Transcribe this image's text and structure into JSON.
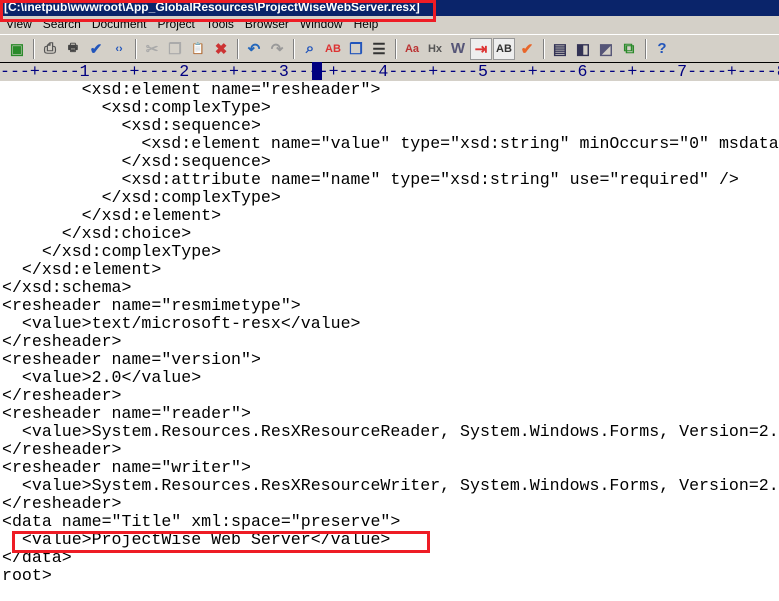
{
  "window": {
    "title": "[C:\\inetpub\\wwwroot\\App_GlobalResources\\ProjectWiseWebServer.resx]"
  },
  "menu": [
    "View",
    "Search",
    "Document",
    "Project",
    "Tools",
    "Browser",
    "Window",
    "Help"
  ],
  "toolbar": [
    {
      "icon": "save-all-icon",
      "glyph": "▣",
      "color": "#2a8a2a"
    },
    {
      "sep": true
    },
    {
      "icon": "print-preview-icon",
      "glyph": "⎙",
      "color": "#555"
    },
    {
      "icon": "print-icon",
      "glyph": "🖶",
      "color": "#444"
    },
    {
      "icon": "spellcheck-icon",
      "glyph": "✔",
      "color": "#2255bb"
    },
    {
      "icon": "html-tag-icon",
      "glyph": "‹›",
      "color": "#2255bb"
    },
    {
      "sep": true
    },
    {
      "icon": "cut-icon",
      "glyph": "✂",
      "color": "#aaa"
    },
    {
      "icon": "copy-icon",
      "glyph": "❐",
      "color": "#aaa"
    },
    {
      "icon": "paste-icon",
      "glyph": "📋",
      "color": "#8a6a2a"
    },
    {
      "icon": "delete-icon",
      "glyph": "✖",
      "color": "#c33"
    },
    {
      "sep": true
    },
    {
      "icon": "undo-icon",
      "glyph": "↶",
      "color": "#2266bb"
    },
    {
      "icon": "redo-icon",
      "glyph": "↷",
      "color": "#999"
    },
    {
      "sep": true
    },
    {
      "icon": "find-icon",
      "glyph": "⌕",
      "color": "#2255bb"
    },
    {
      "icon": "replace-icon",
      "glyph": "AB",
      "color": "#d33"
    },
    {
      "icon": "find-in-files-icon",
      "glyph": "❒",
      "color": "#2255bb"
    },
    {
      "icon": "line-numbers-icon",
      "glyph": "☰",
      "color": "#333"
    },
    {
      "sep": true
    },
    {
      "icon": "font-icon",
      "glyph": "Aa",
      "color": "#b33"
    },
    {
      "icon": "hex-icon",
      "glyph": "Hx",
      "color": "#555"
    },
    {
      "icon": "word-wrap-icon",
      "glyph": "W",
      "color": "#557"
    },
    {
      "icon": "indent-icon",
      "glyph": "⇥",
      "color": "#d33",
      "on": true
    },
    {
      "icon": "sort-icon",
      "glyph": "AB",
      "color": "#333",
      "on": true
    },
    {
      "icon": "check-icon",
      "glyph": "✔",
      "color": "#e8662a"
    },
    {
      "sep": true
    },
    {
      "icon": "list-icon",
      "glyph": "▤",
      "color": "#335"
    },
    {
      "icon": "window-icon",
      "glyph": "◧",
      "color": "#335"
    },
    {
      "icon": "search-window-icon",
      "glyph": "◩",
      "color": "#557"
    },
    {
      "icon": "export-icon",
      "glyph": "⧉",
      "color": "#2a8a2a"
    },
    {
      "sep": true
    },
    {
      "icon": "context-help-icon",
      "glyph": "?",
      "color": "#2255bb"
    }
  ],
  "ruler": "---+----1----+----2----+----3----+----4----+----5----+----6----+----7----+----8",
  "code": [
    "        <xsd:element name=\"resheader\">",
    "          <xsd:complexType>",
    "            <xsd:sequence>",
    "              <xsd:element name=\"value\" type=\"xsd:string\" minOccurs=\"0\" msdata",
    "            </xsd:sequence>",
    "            <xsd:attribute name=\"name\" type=\"xsd:string\" use=\"required\" />",
    "          </xsd:complexType>",
    "        </xsd:element>",
    "      </xsd:choice>",
    "    </xsd:complexType>",
    "  </xsd:element>",
    "</xsd:schema>",
    "<resheader name=\"resmimetype\">",
    "  <value>text/microsoft-resx</value>",
    "</resheader>",
    "<resheader name=\"version\">",
    "  <value>2.0</value>",
    "</resheader>",
    "<resheader name=\"reader\">",
    "  <value>System.Resources.ResXResourceReader, System.Windows.Forms, Version=2.",
    "</resheader>",
    "<resheader name=\"writer\">",
    "  <value>System.Resources.ResXResourceWriter, System.Windows.Forms, Version=2.",
    "</resheader>",
    "<data name=\"Title\" xml:space=\"preserve\">",
    "  <value>ProjectWise Web Server</value>",
    "</data>",
    "root>"
  ],
  "highlight_color": "#ee1c25"
}
